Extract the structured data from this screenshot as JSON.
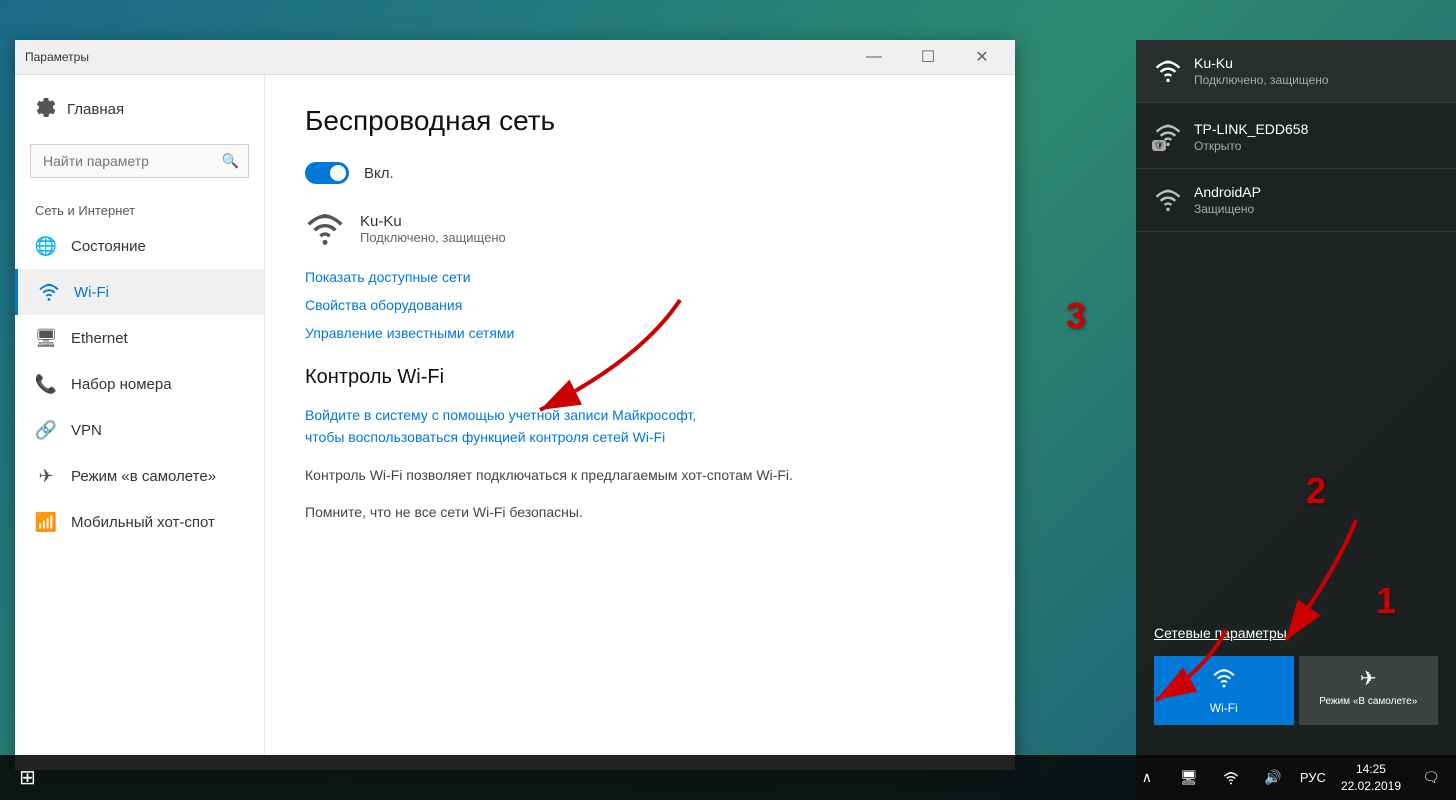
{
  "desktop": {
    "background": "gradient"
  },
  "settings_window": {
    "title": "Параметры",
    "titlebar_controls": [
      "—",
      "☐",
      "✕"
    ],
    "sidebar": {
      "home_label": "Главная",
      "search_placeholder": "Найти параметр",
      "section_header": "Сеть и Интернет",
      "nav_items": [
        {
          "id": "status",
          "label": "Состояние",
          "icon": "globe"
        },
        {
          "id": "wifi",
          "label": "Wi-Fi",
          "icon": "wifi",
          "active": true
        },
        {
          "id": "ethernet",
          "label": "Ethernet",
          "icon": "ethernet"
        },
        {
          "id": "dialup",
          "label": "Набор номера",
          "icon": "phone"
        },
        {
          "id": "vpn",
          "label": "VPN",
          "icon": "vpn"
        },
        {
          "id": "airplane",
          "label": "Режим «в самолете»",
          "icon": "airplane"
        },
        {
          "id": "hotspot",
          "label": "Мобильный хот-спот",
          "icon": "hotspot"
        }
      ]
    },
    "main": {
      "page_title": "Беспроводная сеть",
      "toggle_state": "on",
      "toggle_label": "Вкл.",
      "network_name": "Ku-Ku",
      "network_status": "Подключено, защищено",
      "links": [
        "Показать доступные сети",
        "Свойства оборудования",
        "Управление известными сетями"
      ],
      "section_wifi_control": "Контроль Wi-Fi",
      "wifi_control_link": "Войдите в систему с помощью учетной записи Майкрософт,\nчтобы воспользоваться функцией контроля сетей Wi-Fi",
      "info1": "Контроль Wi-Fi позволяет подключаться к предлагаемым хот-спотам Wi-Fi.",
      "info2": "Помните, что не все сети Wi-Fi безопасны."
    }
  },
  "network_flyout": {
    "networks": [
      {
        "name": "Ku-Ku",
        "status": "Подключено, защищено",
        "connected": true,
        "secured": true
      },
      {
        "name": "TP-LINK_EDD658",
        "status": "Открыто",
        "connected": false,
        "secured": false
      },
      {
        "name": "AndroidAP",
        "status": "Защищено",
        "connected": false,
        "secured": true
      }
    ],
    "settings_link": "Сетевые параметры",
    "quick_actions": [
      {
        "label": "Wi-Fi",
        "icon": "wifi",
        "active": true
      },
      {
        "label": "Режим «В самолете»",
        "icon": "airplane",
        "active": false
      }
    ]
  },
  "taskbar": {
    "time": "14:25",
    "date": "22.02.2019",
    "language": "РУС",
    "icons": [
      "chevron",
      "monitor",
      "wifi",
      "volume",
      "lang",
      "notification"
    ]
  },
  "annotations": {
    "num1": "1",
    "num2": "2",
    "num3": "3"
  }
}
